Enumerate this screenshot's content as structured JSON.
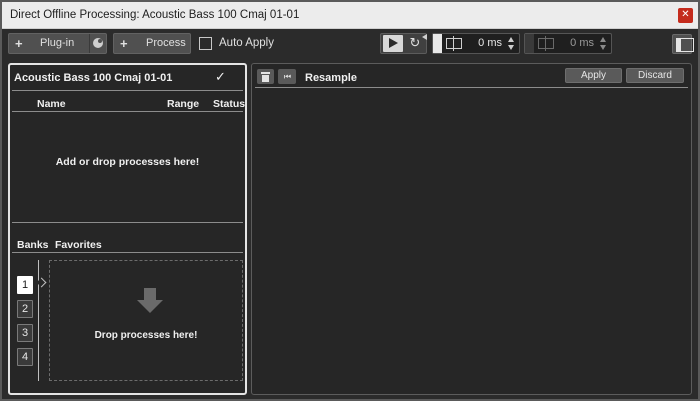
{
  "window": {
    "title": "Direct Offline Processing: Acoustic Bass 100 Cmaj 01-01",
    "close_icon": "close-icon"
  },
  "toolbar": {
    "plugin_label": "Plug-in",
    "process_label": "Process",
    "add_symbol": "+",
    "auto_apply_label": "Auto Apply",
    "auto_apply_checked": false,
    "time1_value": "0 ms",
    "time2_value": "0 ms",
    "loop_glyph": "↻"
  },
  "left_panel": {
    "title": "Acoustic Bass 100 Cmaj 01-01",
    "check_glyph": "✓",
    "columns": {
      "name": "Name",
      "range": "Range",
      "status": "Status"
    },
    "empty_message": "Add or drop processes here!",
    "tabs": {
      "banks": "Banks",
      "favorites": "Favorites"
    },
    "banks": [
      "1",
      "2",
      "3",
      "4"
    ],
    "active_bank": "1",
    "drop_message": "Drop processes here!"
  },
  "right_panel": {
    "title": "Resample",
    "skip_glyph": "⏮",
    "apply_label": "Apply",
    "discard_label": "Discard"
  },
  "colors": {
    "accent_border": "#e4e4e4",
    "close": "#c42b1c",
    "background": "#2b2b2b"
  }
}
